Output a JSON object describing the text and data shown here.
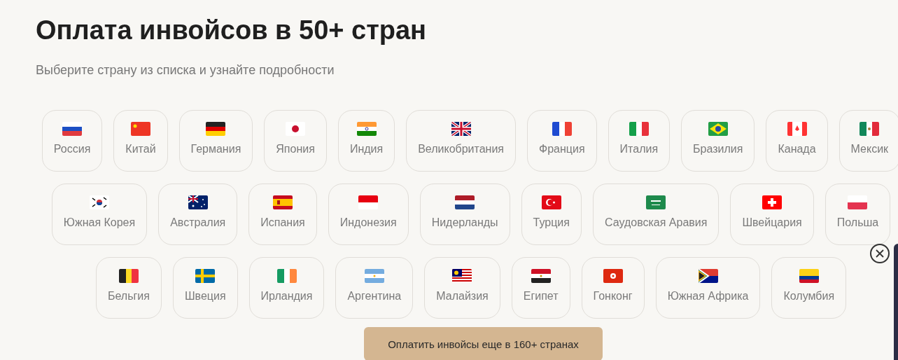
{
  "title": "Оплата инвойсов в 50+ стран",
  "subtitle": "Выберите страну из списка и узнайте подробности",
  "rows": [
    [
      {
        "name": "Россия",
        "kind": "ru"
      },
      {
        "name": "Китай",
        "kind": "cn"
      },
      {
        "name": "Германия",
        "kind": "de"
      },
      {
        "name": "Япония",
        "kind": "jp"
      },
      {
        "name": "Индия",
        "kind": "in"
      },
      {
        "name": "Великобритания",
        "kind": "gb"
      },
      {
        "name": "Франция",
        "kind": "fr"
      },
      {
        "name": "Италия",
        "kind": "it"
      },
      {
        "name": "Бразилия",
        "kind": "br"
      },
      {
        "name": "Канада",
        "kind": "ca"
      },
      {
        "name": "Мексик",
        "kind": "mx"
      }
    ],
    [
      {
        "name": "Южная Корея",
        "kind": "kr"
      },
      {
        "name": "Австралия",
        "kind": "au"
      },
      {
        "name": "Испания",
        "kind": "es"
      },
      {
        "name": "Индонезия",
        "kind": "id"
      },
      {
        "name": "Нидерланды",
        "kind": "nl"
      },
      {
        "name": "Турция",
        "kind": "tr"
      },
      {
        "name": "Саудовская Аравия",
        "kind": "sa"
      },
      {
        "name": "Швейцария",
        "kind": "ch"
      },
      {
        "name": "Польша",
        "kind": "pl"
      }
    ],
    [
      {
        "name": "Бельгия",
        "kind": "be"
      },
      {
        "name": "Швеция",
        "kind": "se"
      },
      {
        "name": "Ирландия",
        "kind": "ie"
      },
      {
        "name": "Аргентина",
        "kind": "ar"
      },
      {
        "name": "Малайзия",
        "kind": "my"
      },
      {
        "name": "Египет",
        "kind": "eg"
      },
      {
        "name": "Гонконг",
        "kind": "hk"
      },
      {
        "name": "Южная Африка",
        "kind": "za"
      },
      {
        "name": "Колумбия",
        "kind": "co"
      }
    ]
  ],
  "more_button": "Оплатить инвойсы еще в 160+ странах"
}
